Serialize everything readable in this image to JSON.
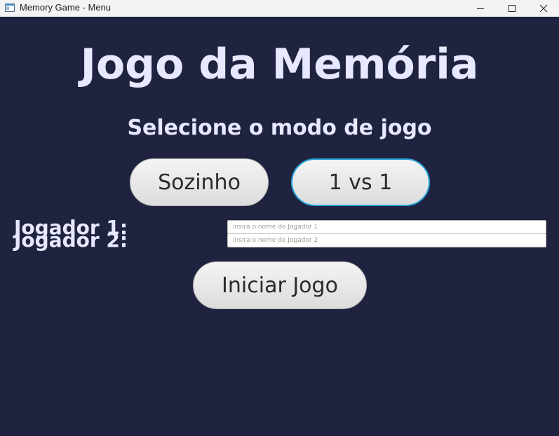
{
  "window": {
    "title": "Memory Game - Menu",
    "icons": [
      "app-icon",
      "minimize-icon",
      "maximize-icon",
      "close-icon"
    ]
  },
  "menu": {
    "title": "Jogo da Memória",
    "subtitle": "Selecione o modo de jogo",
    "mode_solo": "Sozinho",
    "mode_versus": "1 vs 1",
    "selected_mode": "1 vs 1",
    "player1_label": "Jogador 1:",
    "player2_label": "Jogador 2:",
    "player1_value": "",
    "player2_value": "",
    "player1_placeholder": "insira o nome do Jogador 1",
    "player2_placeholder": "insira o nome do Jogador 2",
    "start": "Iniciar Jogo"
  },
  "colors": {
    "background": "#20233f",
    "text": "#e6e9ff",
    "focus_border": "#27a2d8"
  }
}
